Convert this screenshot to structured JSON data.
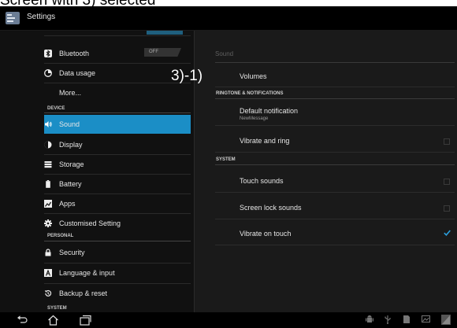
{
  "caption": "Screen with 3) selected",
  "titlebar": {
    "title": "Settings"
  },
  "sidebar": {
    "wifi_toggle_label": "OFF",
    "items_top": [
      {
        "label": "Bluetooth",
        "icon": "bluetooth-icon",
        "toggle": "OFF"
      },
      {
        "label": "Data usage",
        "icon": "data-usage-icon"
      },
      {
        "label": "More..."
      }
    ],
    "sections": {
      "device": "DEVICE",
      "personal": "PERSONAL",
      "system": "SYSTEM"
    },
    "device_items": [
      {
        "label": "Sound",
        "icon": "speaker-icon",
        "selected": true
      },
      {
        "label": "Display",
        "icon": "display-icon"
      },
      {
        "label": "Storage",
        "icon": "storage-icon"
      },
      {
        "label": "Battery",
        "icon": "battery-icon"
      },
      {
        "label": "Apps",
        "icon": "apps-icon"
      },
      {
        "label": "Customised Setting",
        "icon": "gear-icon"
      }
    ],
    "personal_items": [
      {
        "label": "Security",
        "icon": "lock-icon"
      },
      {
        "label": "Language & input",
        "icon": "keyboard-icon"
      },
      {
        "label": "Backup & reset",
        "icon": "backup-icon"
      }
    ]
  },
  "main": {
    "header": "Sound",
    "overlay_label": "3)-1)",
    "volumes": "Volumes",
    "sections": {
      "ringtone": "RINGTONE & NOTIFICATIONS",
      "system": "SYSTEM"
    },
    "default_notification": {
      "title": "Default notification",
      "value": "NewMessage"
    },
    "vibrate_and_ring": {
      "label": "Vibrate and ring",
      "checked": false
    },
    "touch_sounds": {
      "label": "Touch sounds",
      "checked": false
    },
    "screen_lock_sounds": {
      "label": "Screen lock sounds",
      "checked": false
    },
    "vibrate_on_touch": {
      "label": "Vibrate on touch",
      "checked": true
    }
  },
  "colors": {
    "accent": "#1b8ec6",
    "check": "#2a9fdd"
  }
}
